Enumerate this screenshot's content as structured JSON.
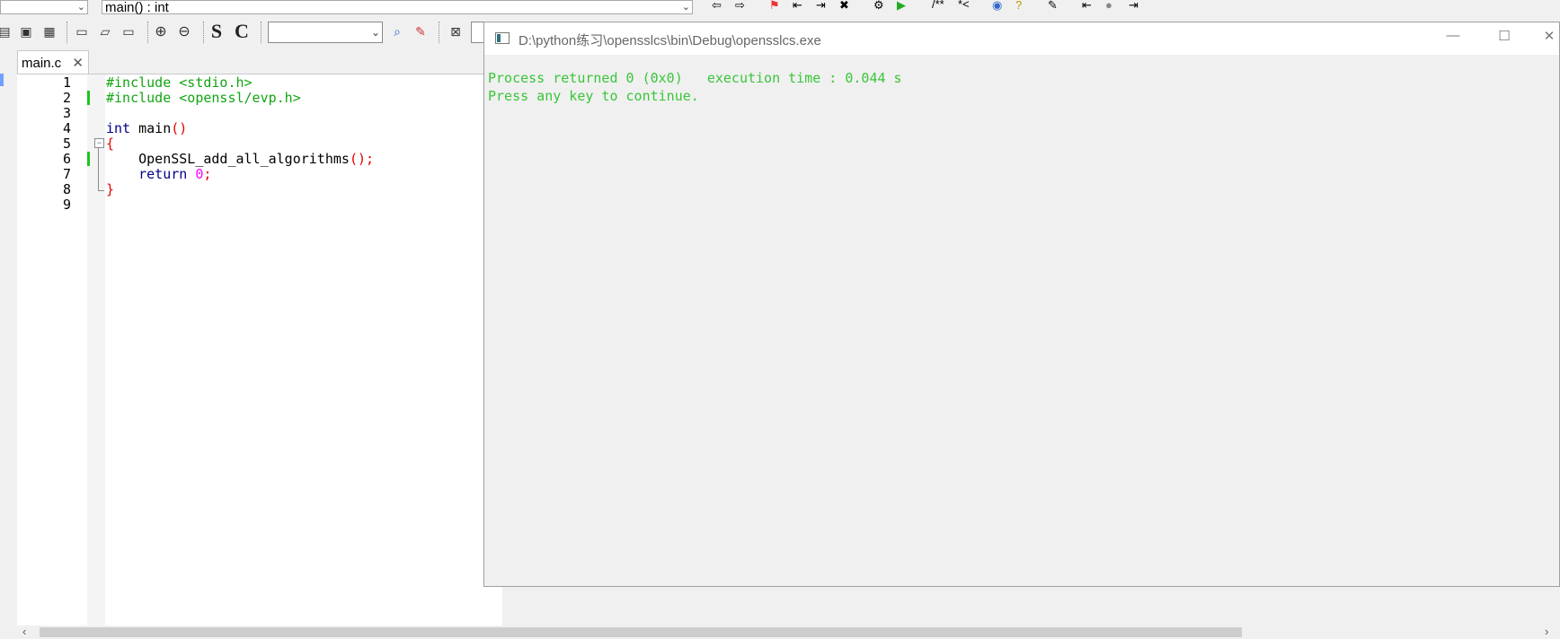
{
  "ide": {
    "scope_combo_left": "",
    "scope_combo": "main() : int",
    "search_value": ""
  },
  "toolbar": {
    "letter_s": "S",
    "letter_c": "C"
  },
  "editor": {
    "tab_label": "main.c",
    "tab_close": "✕",
    "lines": [
      {
        "num": "1",
        "parts": [
          {
            "t": "#include <stdio.h>",
            "c": "pp"
          }
        ]
      },
      {
        "num": "2",
        "parts": [
          {
            "t": "#include <openssl/evp.h>",
            "c": "pp"
          }
        ]
      },
      {
        "num": "3",
        "parts": []
      },
      {
        "num": "4",
        "parts": [
          {
            "t": "int",
            "c": "kw"
          },
          {
            "t": " main",
            "c": "tx"
          },
          {
            "t": "()",
            "c": "br"
          }
        ]
      },
      {
        "num": "5",
        "parts": [
          {
            "t": "{",
            "c": "br"
          }
        ]
      },
      {
        "num": "6",
        "parts": [
          {
            "t": "    OpenSSL_add_all_algorithms",
            "c": "tx"
          },
          {
            "t": "();",
            "c": "br"
          }
        ]
      },
      {
        "num": "7",
        "parts": [
          {
            "t": "    ",
            "c": "tx"
          },
          {
            "t": "return",
            "c": "kw"
          },
          {
            "t": " ",
            "c": "tx"
          },
          {
            "t": "0",
            "c": "nm"
          },
          {
            "t": ";",
            "c": "br"
          }
        ]
      },
      {
        "num": "8",
        "parts": [
          {
            "t": "}",
            "c": "br"
          }
        ]
      },
      {
        "num": "9",
        "parts": []
      }
    ],
    "changed_lines": [
      2,
      6
    ]
  },
  "console": {
    "title": "D:\\python练习\\opensslcs\\bin\\Debug\\opensslcs.exe",
    "output_line1": "Process returned 0 (0x0)   execution time : 0.044 s",
    "output_line2": "Press any key to continue.",
    "minimize": "—",
    "maximize": "☐",
    "close": "✕"
  },
  "colors": {
    "console_text": "#39c639",
    "preprocessor": "#12a512",
    "keyword": "#00008b",
    "brace": "#e00000",
    "number": "#ff00ff"
  }
}
